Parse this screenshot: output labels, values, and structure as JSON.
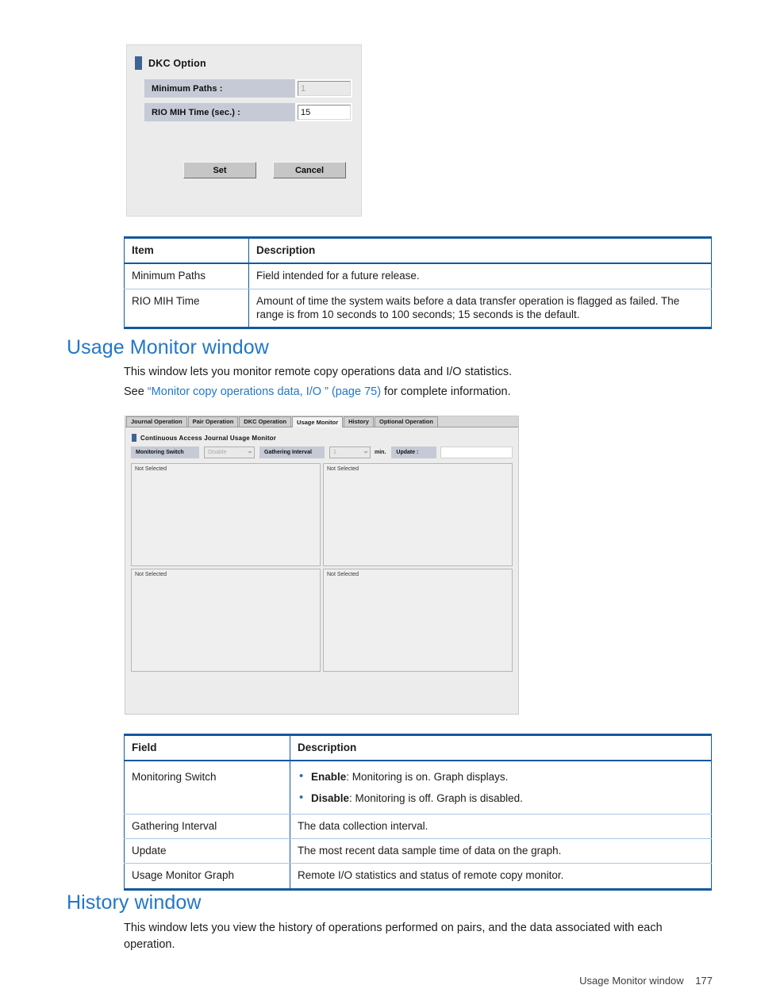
{
  "dkc_dialog": {
    "title": "DKC Option",
    "fields": [
      {
        "label": "Minimum Paths :",
        "value": "1",
        "disabled": true
      },
      {
        "label": "RIO MIH Time (sec.) :",
        "value": "15",
        "disabled": false
      }
    ],
    "set_label": "Set",
    "cancel_label": "Cancel"
  },
  "dkc_table": {
    "headers": [
      "Item",
      "Description"
    ],
    "rows": [
      {
        "item": "Minimum Paths",
        "description": "Field intended for a future release."
      },
      {
        "item": "RIO MIH Time",
        "description": "Amount of time the system waits before a data transfer operation is flagged as failed. The range is from 10 seconds to 100 seconds; 15 seconds is the default."
      }
    ]
  },
  "usage_section": {
    "heading": "Usage Monitor window",
    "paragraph1": "This window lets you monitor remote copy operations data and I/O statistics.",
    "paragraph2_before": "See ",
    "paragraph2_link": "“Monitor copy operations data, I/O ” (page 75)",
    "paragraph2_after": " for complete information."
  },
  "usage_monitor_window": {
    "tabs": [
      {
        "label": "Journal Operation",
        "active": false
      },
      {
        "label": "Pair Operation",
        "active": false
      },
      {
        "label": "DKC Operation",
        "active": false
      },
      {
        "label": "Usage Monitor",
        "active": true
      },
      {
        "label": "History",
        "active": false
      },
      {
        "label": "Optional Operation",
        "active": false
      }
    ],
    "panel_title": "Continuous Access Journal Usage Monitor",
    "monitoring_switch_label": "Monitoring Switch",
    "monitoring_switch_value": "Disable",
    "gathering_interval_label": "Gathering Interval",
    "gathering_interval_value": "1",
    "gathering_interval_unit": "min.",
    "update_label": "Update :",
    "update_value": "",
    "graphs": [
      {
        "status": "Not Selected"
      },
      {
        "status": "Not Selected"
      },
      {
        "status": "Not Selected"
      },
      {
        "status": "Not Selected"
      }
    ]
  },
  "usage_table": {
    "headers": [
      "Field",
      "Description"
    ],
    "rows": [
      {
        "field": "Monitoring Switch",
        "bullets": [
          {
            "term": "Enable",
            "text": ": Monitoring is on. Graph displays."
          },
          {
            "term": "Disable",
            "text": ": Monitoring is off. Graph is disabled."
          }
        ]
      },
      {
        "field": "Gathering Interval",
        "description": "The data collection interval."
      },
      {
        "field": "Update",
        "description": "The most recent data sample time of data on the graph."
      },
      {
        "field": "Usage Monitor Graph",
        "description": "Remote I/O statistics and status of remote copy monitor."
      }
    ]
  },
  "history_section": {
    "heading": "History window",
    "paragraph": "This window lets you view the history of operations performed on pairs, and the data associated with each operation."
  },
  "footer": {
    "title": "Usage Monitor window",
    "page": "177"
  },
  "colors": {
    "heading_blue": "#2277c8",
    "table_border_blue": "#13599e",
    "accent_bar": "#3d6393",
    "label_bg": "#c5cad6",
    "bullet_blue": "#2f6fa8"
  }
}
